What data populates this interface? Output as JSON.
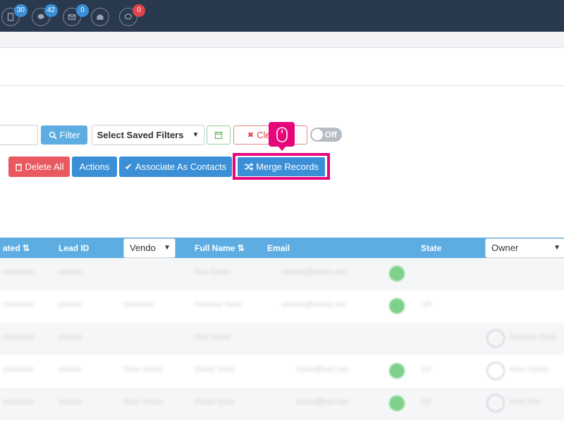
{
  "topbar": {
    "badges": [
      {
        "icon": "document-icon",
        "count": "30"
      },
      {
        "icon": "chat-icon",
        "count": "42"
      },
      {
        "icon": "mail-icon",
        "count": "0"
      },
      {
        "icon": "open-mail-icon",
        "count": ""
      },
      {
        "icon": "comment-icon",
        "count": "0"
      }
    ]
  },
  "toolbar": {
    "filter_label": "Filter",
    "saved_filters_label": "Select Saved Filters",
    "clear_label": "Clear ...s",
    "toggle_label": "Off",
    "delete_all_label": "Delete All",
    "actions_label": "Actions",
    "associate_label": "Associate As Contacts",
    "merge_label": "Merge Records"
  },
  "table": {
    "headers": {
      "created": "ated",
      "lead_id": "Lead ID",
      "vendor": "Vendo",
      "full_name": "Full Name",
      "email": "Email",
      "state": "State",
      "owner": "Owner"
    },
    "rows": [
      {
        "created": "xxxxxxxx",
        "lead_id": "xxxxxx",
        "vendor": "",
        "name": "Xxx Xxxxx",
        "email": "xxxxxx@xxxxx.xxx",
        "status": true,
        "state": "",
        "owner": ""
      },
      {
        "created": "xxxxxxxx",
        "lead_id": "xxxxxx",
        "vendor": "xxxxxxxx",
        "name": "Xxxxxxx Xxxx",
        "email": "xxxxxx@xxxxx.xxx",
        "status": true,
        "state": "XX",
        "owner": ""
      },
      {
        "created": "xxxxxxxx",
        "lead_id": "xxxxxx",
        "vendor": "",
        "name": "Xxx Xxxxx",
        "email": "",
        "status": false,
        "state": "",
        "owner": "Xxxxxxx Xxxx"
      },
      {
        "created": "xxxxxxxx",
        "lead_id": "xxxxxx",
        "vendor": "Xxxx Xxxxx",
        "name": "Xxxxx Xxxx",
        "email": "xxxxx@xxx.xxx",
        "status": true,
        "state": "XX",
        "owner": "Xxxx Xxxxx"
      },
      {
        "created": "xxxxxxxx",
        "lead_id": "xxxxxx",
        "vendor": "Xxxx Xxxxx",
        "name": "Xxxxx Xxxx",
        "email": "xxxxx@xxx.xxx",
        "status": true,
        "state": "XX",
        "owner": "Xxxx Xxx"
      }
    ]
  },
  "colors": {
    "topbar": "#2a3a4e",
    "primary": "#3a8fd6",
    "header": "#5dade2",
    "danger": "#e85a5f",
    "highlight": "#e6057a"
  }
}
